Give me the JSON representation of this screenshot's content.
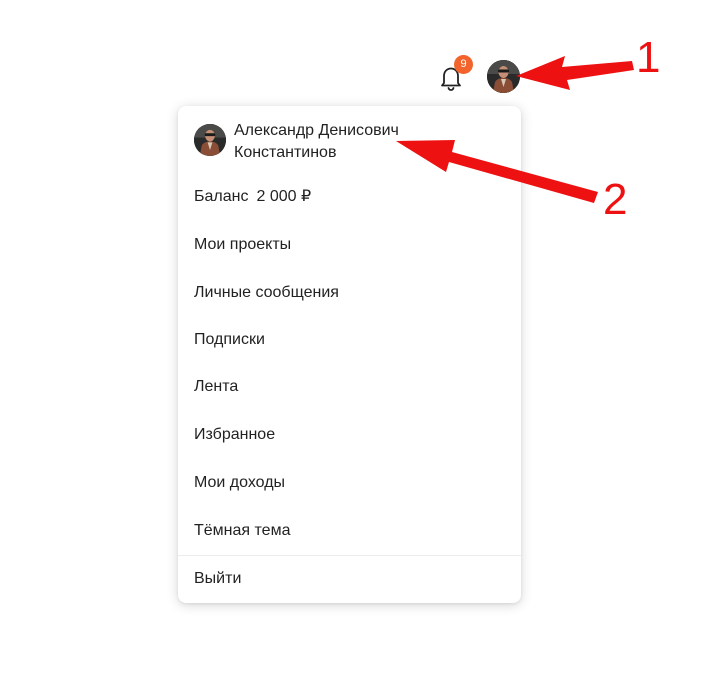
{
  "header": {
    "notifications_icon": "bell-icon",
    "notifications_count": "9",
    "avatar_icon": "user-avatar"
  },
  "menu": {
    "user_name": "Александр Денисович Константинов",
    "balance_label": "Баланс",
    "balance_value": "2 000 ₽",
    "items": [
      {
        "label": "Мои проекты"
      },
      {
        "label": "Личные сообщения"
      },
      {
        "label": "Подписки"
      },
      {
        "label": "Лента"
      },
      {
        "label": "Избранное"
      },
      {
        "label": "Мои доходы"
      },
      {
        "label": "Тёмная тема"
      }
    ],
    "logout_label": "Выйти"
  },
  "annotations": {
    "marker_1": "1",
    "marker_2": "2",
    "color": "#ee1111"
  },
  "colors": {
    "badge": "#f2642c",
    "text": "#222222",
    "divider": "#ececec"
  }
}
